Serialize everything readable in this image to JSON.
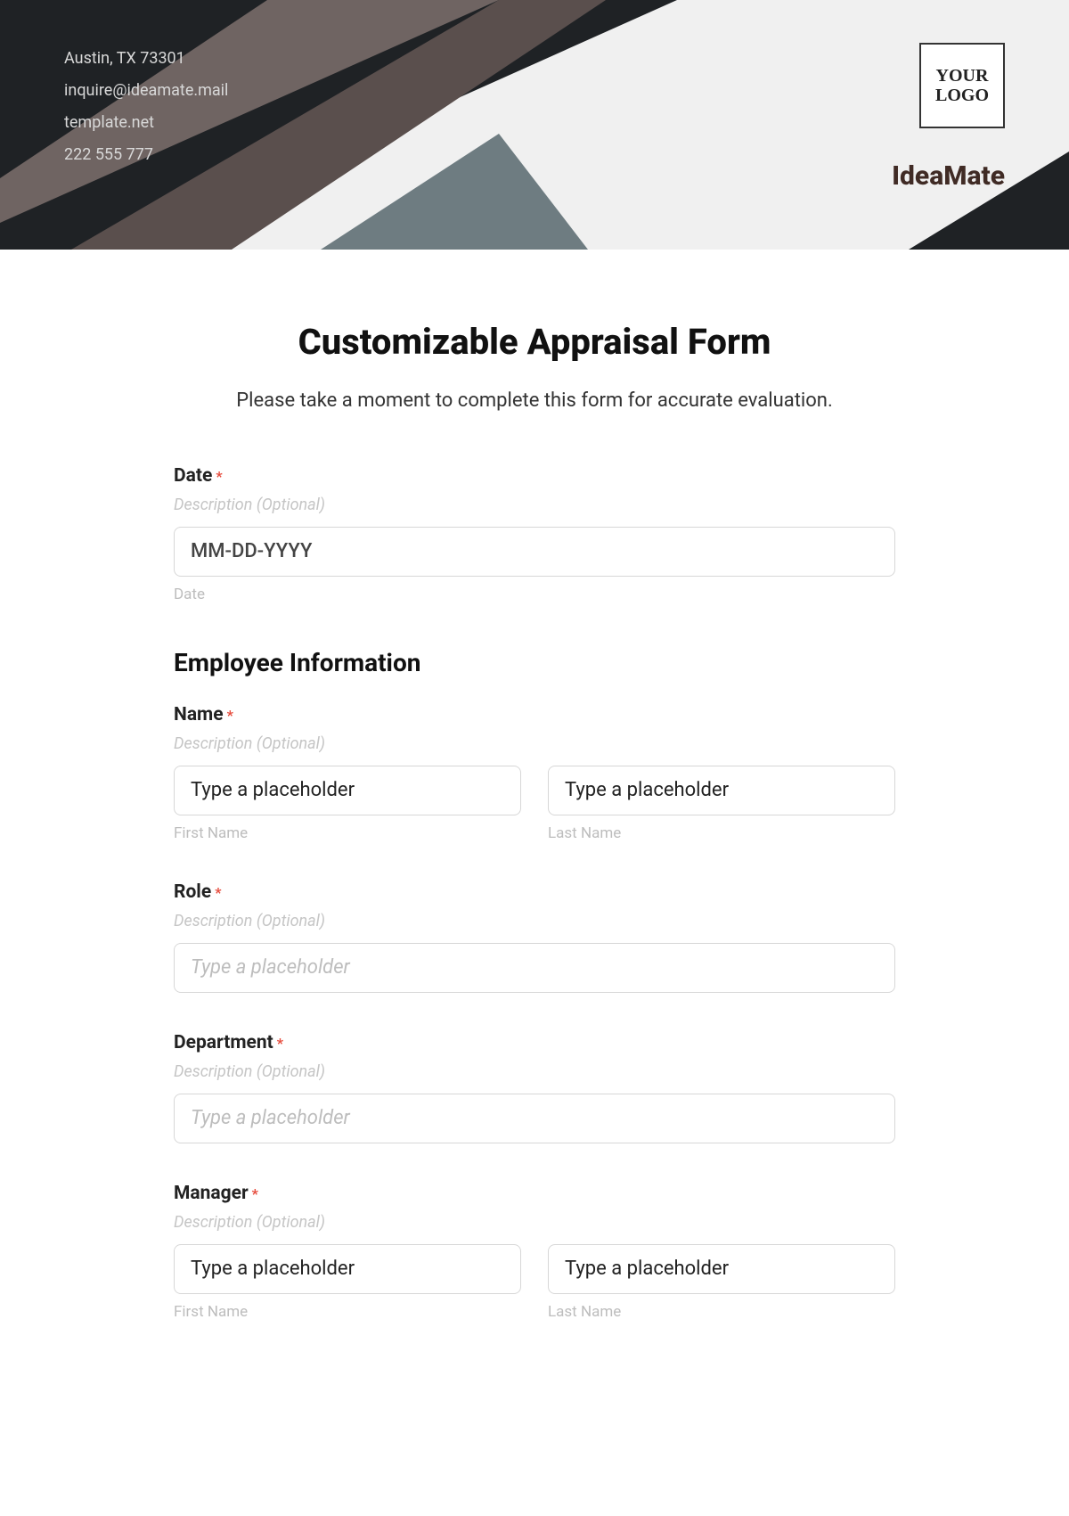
{
  "header": {
    "address": "Austin, TX 73301",
    "email": "inquire@ideamate.mail",
    "site": "template.net",
    "phone": "222 555 777",
    "logo_text": "YOUR LOGO",
    "brand": "IdeaMate"
  },
  "form": {
    "title": "Customizable Appraisal Form",
    "subtitle": "Please take a moment to complete this form for accurate evaluation.",
    "date": {
      "label": "Date",
      "required": "*",
      "desc": "Description (Optional)",
      "placeholder": "MM-DD-YYYY",
      "sublabel": "Date"
    },
    "section_employee": "Employee Information",
    "name": {
      "label": "Name",
      "required": "*",
      "desc": "Description (Optional)",
      "first_placeholder": "Type a placeholder",
      "last_placeholder": "Type a placeholder",
      "first_sub": "First Name",
      "last_sub": "Last Name"
    },
    "role": {
      "label": "Role",
      "required": "*",
      "desc": "Description (Optional)",
      "placeholder": "Type a placeholder"
    },
    "department": {
      "label": "Department",
      "required": "*",
      "desc": "Description (Optional)",
      "placeholder": "Type a placeholder"
    },
    "manager": {
      "label": "Manager",
      "required": "*",
      "desc": "Description (Optional)",
      "first_placeholder": "Type a placeholder",
      "last_placeholder": "Type a placeholder",
      "first_sub": "First Name",
      "last_sub": "Last Name"
    }
  }
}
